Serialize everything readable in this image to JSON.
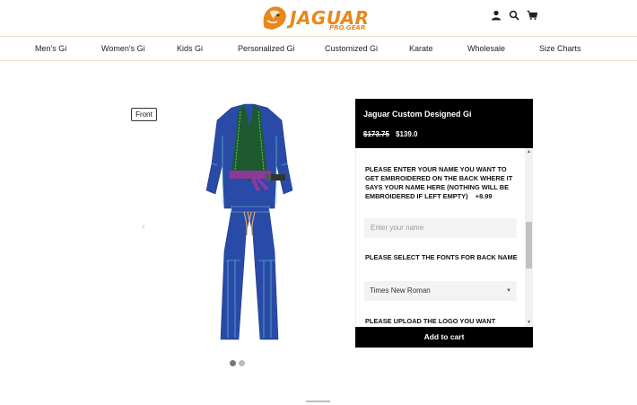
{
  "brand": {
    "name": "JAGUAR",
    "tagline": "PRO GEAR"
  },
  "header_icons": [
    "user-icon",
    "search-icon",
    "cart-icon"
  ],
  "nav": [
    "Men's Gi",
    "Women's Gi",
    "Kids Gi",
    "Personalized Gi",
    "Customized Gi",
    "Karate",
    "Wholesale",
    "Size Charts"
  ],
  "gallery": {
    "view_label": "Front",
    "prev_arrow": "‹",
    "slide_count": 2,
    "active_slide": 1
  },
  "product": {
    "title": "Jaguar Custom Designed Gi",
    "price_original": "$173.75",
    "price_sale": "$139.0",
    "option1_label": "PLEASE ENTER YOUR NAME YOU WANT TO GET EMBROIDERED ON THE BACK WHERE IT SAYS YOUR NAME HERE (NOTHING WILL BE EMBROIDERED IF LEFT EMPTY)",
    "option1_price": "+8.99",
    "name_placeholder": "Enter your name",
    "option2_label": "PLEASE SELECT THE FONTS FOR BACK NAME",
    "font_selected": "Times New Roman",
    "option3_label": "PLEASE UPLOAD THE LOGO YOU WANT",
    "add_to_cart": "Add to cart"
  },
  "colors": {
    "accent": "#e8871a",
    "gi_blue": "#2a4aa8",
    "belt": "#8b3a9a",
    "collar": "#1f5a2e"
  }
}
